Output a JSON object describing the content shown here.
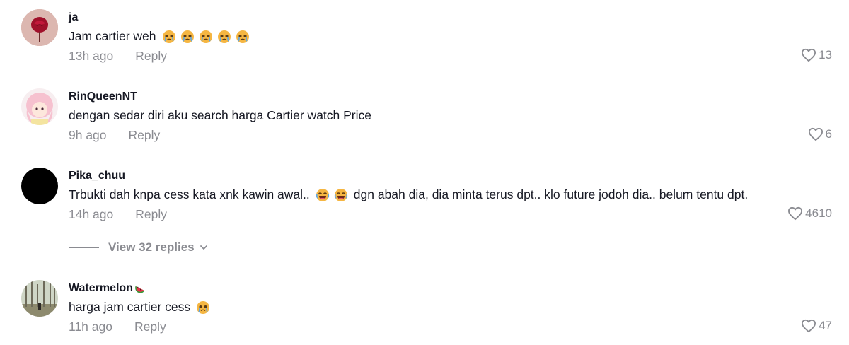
{
  "comments": [
    {
      "username": "ja",
      "text": "Jam cartier weh",
      "emojis": [
        "crying-face",
        "crying-face",
        "crying-face",
        "crying-face",
        "crying-face"
      ],
      "time": "13h ago",
      "reply_label": "Reply",
      "likes": "13",
      "avatar": "red-rose-avatar"
    },
    {
      "username": "RinQueenNT",
      "text": "dengan sedar diri aku search harga Cartier watch Price",
      "time": "9h ago",
      "reply_label": "Reply",
      "likes": "6",
      "avatar": "anime-girl-avatar"
    },
    {
      "username": "Pika_chuu",
      "text_before": "Trbukti dah knpa cess kata xnk kawin awal..",
      "emojis": [
        "laughing-face",
        "laughing-face"
      ],
      "text_after": "dgn abah dia, dia minta terus dpt.. klo future jodoh dia.. belum tentu dpt.",
      "time": "14h ago",
      "reply_label": "Reply",
      "likes": "4610",
      "avatar": "black-avatar"
    },
    {
      "username": "Watermelon",
      "username_emoji": "watermelon",
      "text": "harga jam cartier cess",
      "emojis": [
        "crying-face"
      ],
      "time": "11h ago",
      "reply_label": "Reply",
      "likes": "47",
      "avatar": "forest-avatar"
    }
  ],
  "view_replies": {
    "label": "View 32 replies",
    "icon": "chevron-down-icon"
  },
  "colors": {
    "primary_text": "#161823",
    "secondary_text": "#8a8b91",
    "background": "#ffffff"
  }
}
